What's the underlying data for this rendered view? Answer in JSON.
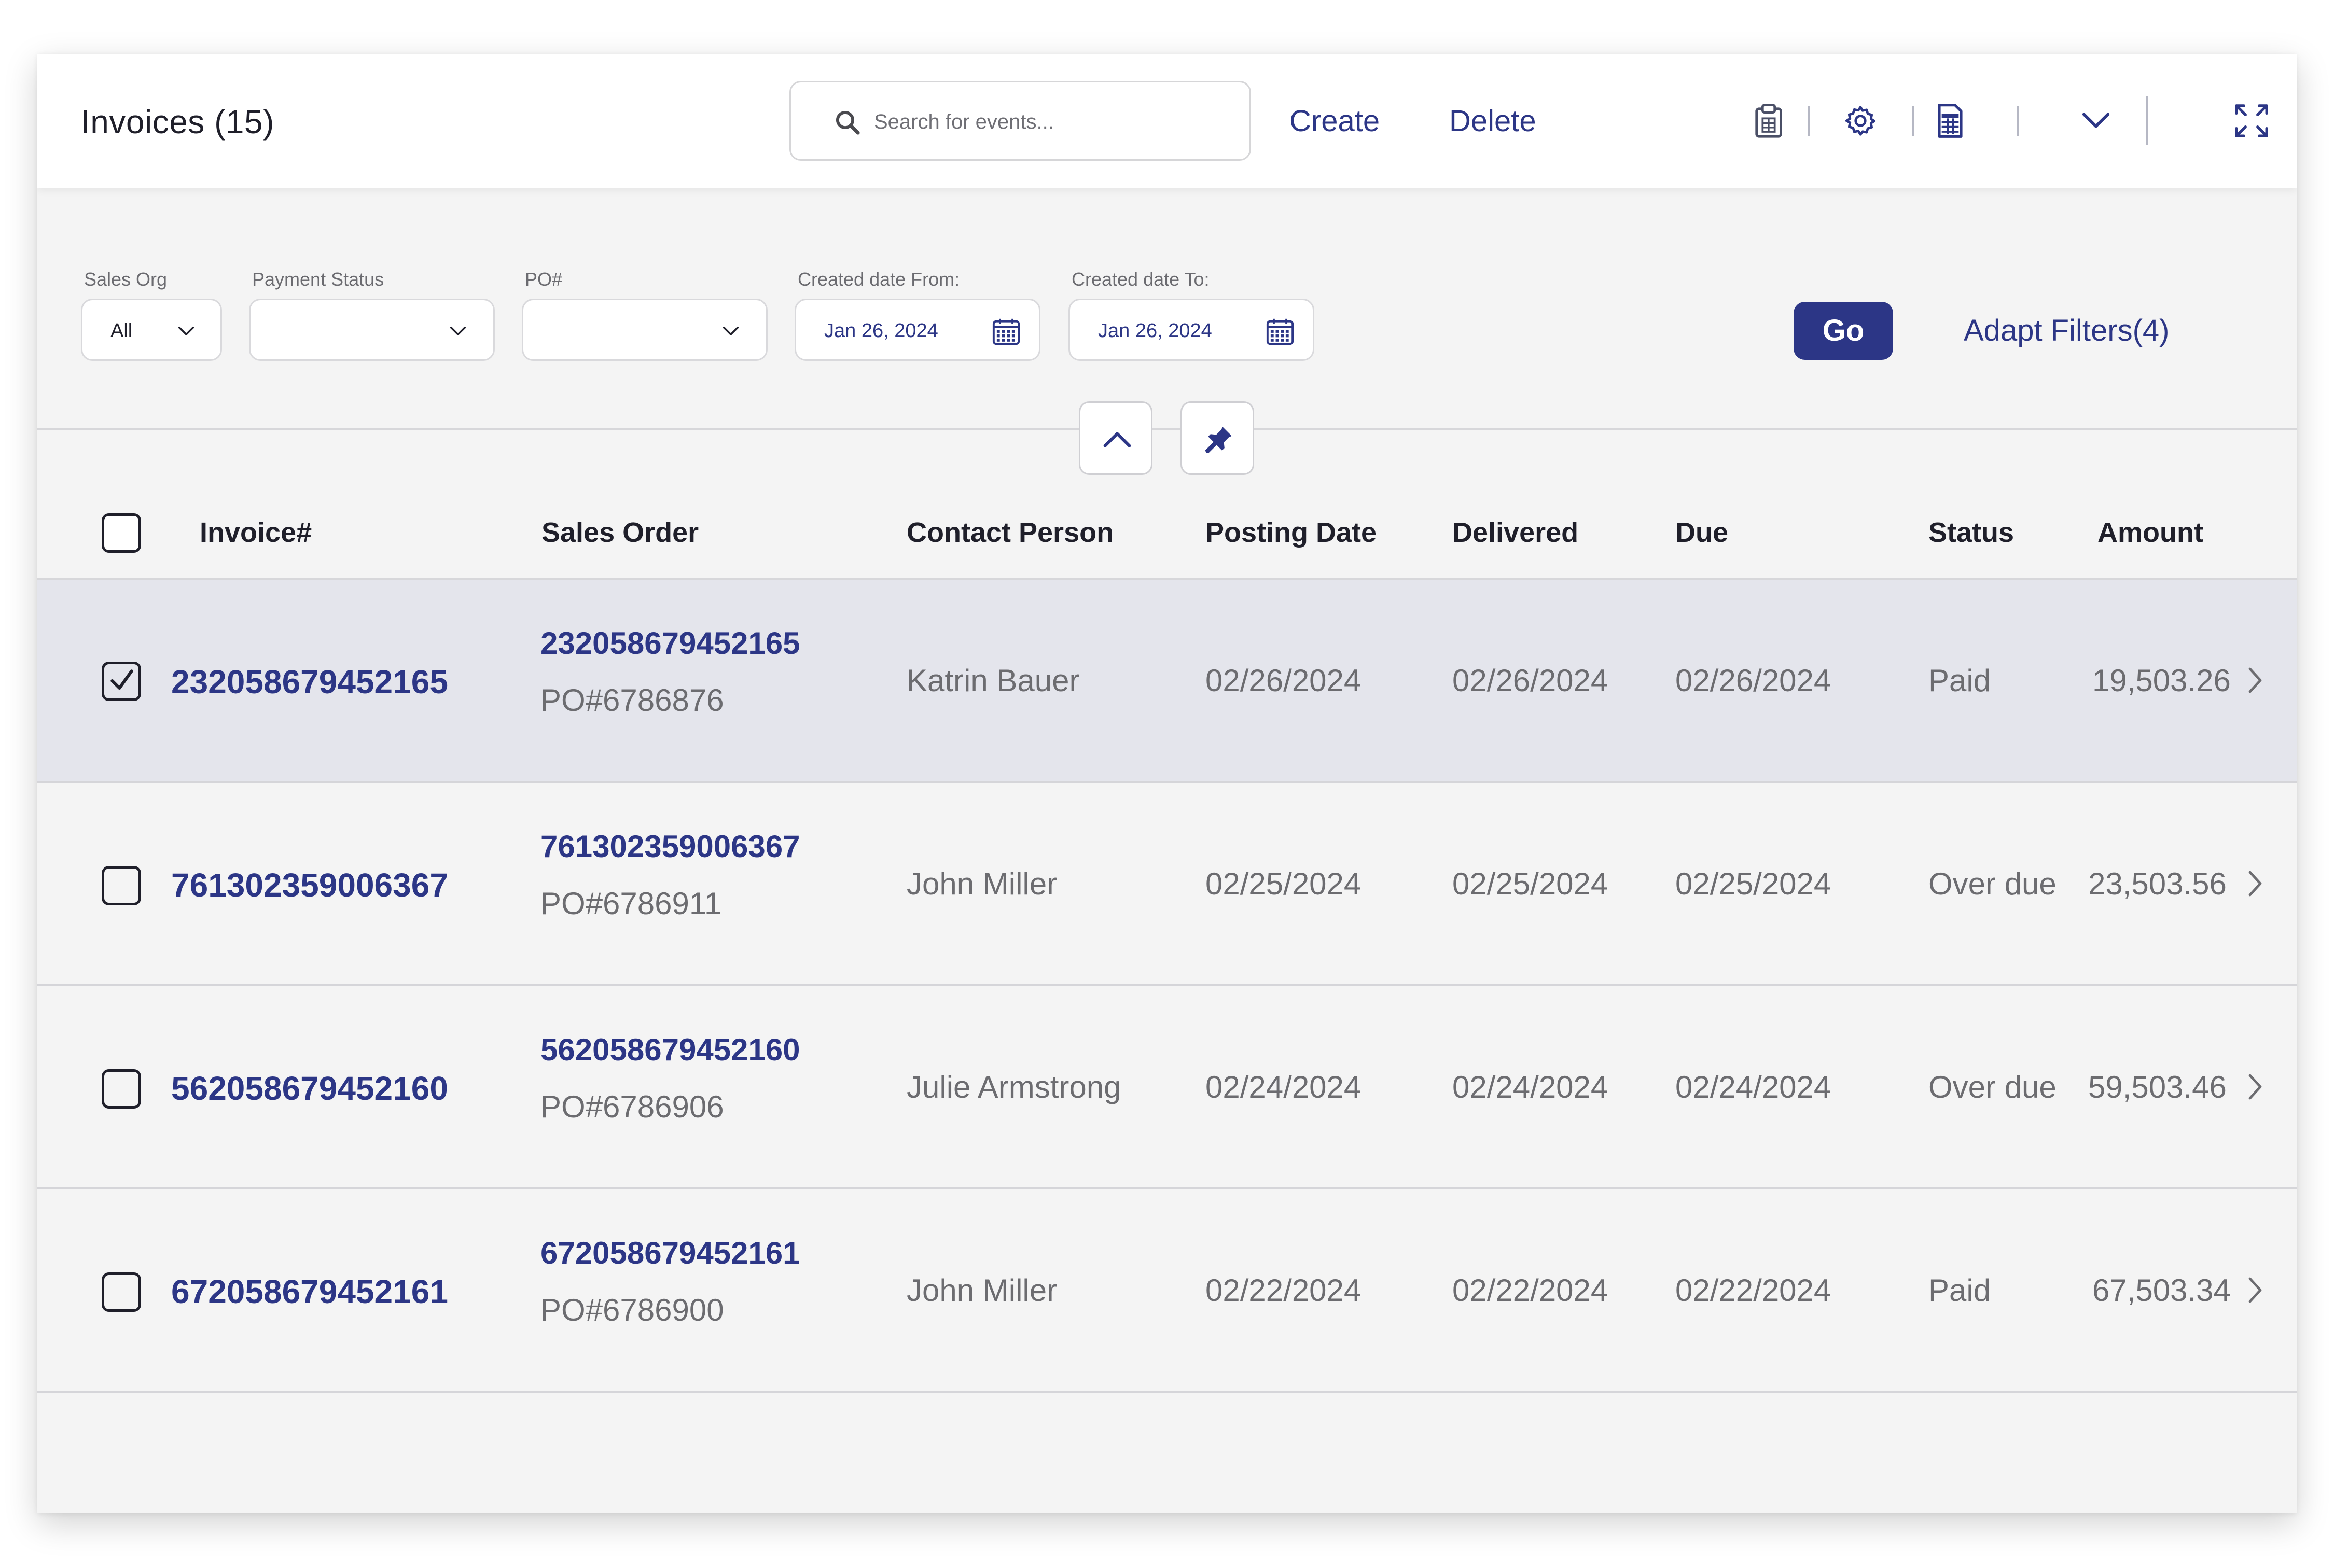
{
  "header": {
    "title": "Invoices (15)",
    "search_placeholder": "Search for events...",
    "create_label": "Create",
    "delete_label": "Delete"
  },
  "filters": {
    "sales_org": {
      "label": "Sales Org",
      "value": "All"
    },
    "payment_status": {
      "label": "Payment Status",
      "value": ""
    },
    "po": {
      "label": "PO#",
      "value": ""
    },
    "created_from": {
      "label": "Created date From:",
      "value": "Jan 26, 2024"
    },
    "created_to": {
      "label": "Created date To:",
      "value": "Jan 26, 2024"
    },
    "go_label": "Go",
    "adapt_label": "Adapt Filters(4)"
  },
  "table": {
    "columns": {
      "invoice": "Invoice#",
      "sales_order": "Sales Order",
      "contact": "Contact Person",
      "posting": "Posting Date",
      "delivered": "Delivered",
      "due": "Due",
      "status": "Status",
      "amount": "Amount"
    },
    "rows": [
      {
        "invoice": "232058679452165",
        "sales_order": "232058679452165",
        "po": "PO#6786876",
        "contact": "Katrin Bauer",
        "posting": "02/26/2024",
        "delivered": "02/26/2024",
        "due": "02/26/2024",
        "status": "Paid",
        "amount": "19,503.26",
        "selected": true
      },
      {
        "invoice": "761302359006367",
        "sales_order": "761302359006367",
        "po": "PO#6786911",
        "contact": "John Miller",
        "posting": "02/25/2024",
        "delivered": "02/25/2024",
        "due": "02/25/2024",
        "status": "Over due",
        "amount": "23,503.56",
        "selected": false
      },
      {
        "invoice": "562058679452160",
        "sales_order": "562058679452160",
        "po": "PO#6786906",
        "contact": "Julie Armstrong",
        "posting": "02/24/2024",
        "delivered": "02/24/2024",
        "due": "02/24/2024",
        "status": "Over due",
        "amount": "59,503.46",
        "selected": false
      },
      {
        "invoice": "672058679452161",
        "sales_order": "672058679452161",
        "po": "PO#6786900",
        "contact": "John Miller",
        "posting": "02/22/2024",
        "delivered": "02/22/2024",
        "due": "02/22/2024",
        "status": "Paid",
        "amount": "67,503.34",
        "selected": false
      }
    ]
  },
  "colors": {
    "accent": "#2c3686",
    "selected_row": "#e4e5ec",
    "background": "#f4f4f4"
  },
  "icons": [
    "search-icon",
    "clipboard-icon",
    "gear-icon",
    "spreadsheet-icon",
    "chevron-down-icon",
    "expand-icon",
    "calendar-icon",
    "chevron-up-icon",
    "pin-icon",
    "chevron-right-icon",
    "check-icon"
  ]
}
